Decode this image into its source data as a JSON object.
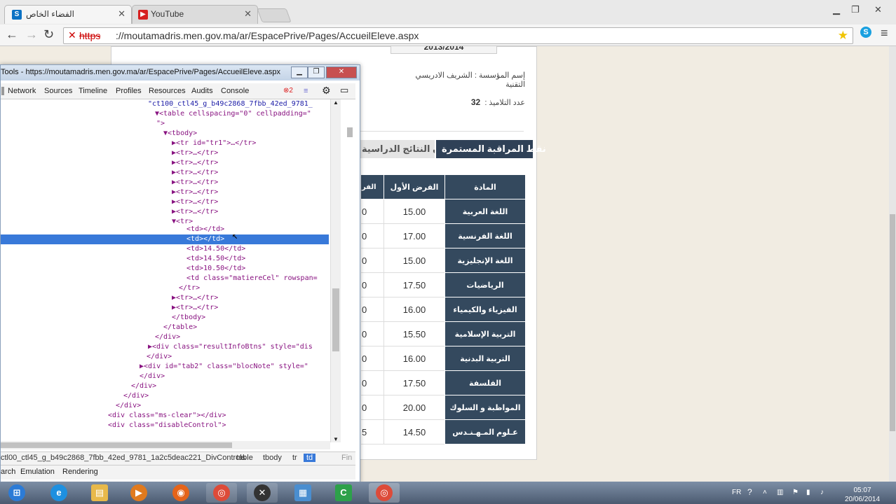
{
  "browser": {
    "tabs": [
      {
        "title": "الفضاء الخاص",
        "icon": "sharepoint-icon"
      },
      {
        "title": "YouTube",
        "icon": "youtube-icon"
      }
    ],
    "url_scheme": "https",
    "url_rest": "://moutamadris.men.gov.ma/ar/EspacePrive/Pages/AccueilEleve.aspx",
    "colors": {
      "titlebar": "#e9e9e9",
      "devtools_selected": "#3879d9",
      "grid_header": "#34495e"
    }
  },
  "page": {
    "info_rows": [
      {
        "label": "إسم المؤسسة :",
        "value": "الشريف الادريسي التقنية"
      },
      {
        "label": "عدد التلاميذ :",
        "value": "32"
      }
    ],
    "top_partial": {
      "value": "2013/2014"
    },
    "tabs": [
      "نقط المراقبة المستمرة",
      "بيان النتائج الدراسية"
    ],
    "table": {
      "columns": [
        "المادة",
        "الفرض الأول",
        "الفر"
      ],
      "rows": [
        {
          "subject": "اللغة العربية",
          "grade1": "15.00",
          "grade2": "0"
        },
        {
          "subject": "اللغة الفرنسية",
          "grade1": "17.00",
          "grade2": "0"
        },
        {
          "subject": "اللغة الإنجليزية",
          "grade1": "15.00",
          "grade2": "0"
        },
        {
          "subject": "الرياضيات",
          "grade1": "17.50",
          "grade2": "0"
        },
        {
          "subject": "الفيزياء والكيمياء",
          "grade1": "16.00",
          "grade2": "0"
        },
        {
          "subject": "التربية الإسلامية",
          "grade1": "15.50",
          "grade2": "0"
        },
        {
          "subject": "التربية البدنية",
          "grade1": "16.00",
          "grade2": "0"
        },
        {
          "subject": "الفلسفة",
          "grade1": "17.50",
          "grade2": "0"
        },
        {
          "subject": "المواظبة و السلوك",
          "grade1": "20.00",
          "grade2": "0"
        },
        {
          "subject": "عـلوم المـهـنـدس",
          "grade1": "14.50",
          "grade2": "5"
        }
      ]
    }
  },
  "devtools": {
    "title": "Tools - https://moutamadris.men.gov.ma/ar/EspacePrive/Pages/AccueilEleve.aspx",
    "tabs": [
      "Network",
      "Sources",
      "Timeline",
      "Profiles",
      "Resources",
      "Audits",
      "Console"
    ],
    "error_count": "2",
    "breadcrumbs": [
      "ctl00_ctl45_g_b49c2868_7fbb_42ed_9781_1a2c5deac221_DivControls",
      "table",
      "tbody",
      "tr",
      "td",
      "Fin"
    ],
    "drawer_tabs": [
      "arch",
      "Emulation",
      "Rendering"
    ],
    "dom_lines": [
      "\"ct100_ctl45_g_b49c2868_7fbb_42ed_9781_",
      "▼<table cellspacing=\"0\" cellpadding=\"",
      "\">",
      "▼<tbody>",
      "▶<tr id=\"tr1\">…</tr>",
      "▶<tr>…</tr>",
      "▶<tr>…</tr>",
      "▶<tr>…</tr>",
      "▶<tr>…</tr>",
      "▶<tr>…</tr>",
      "▶<tr>…</tr>",
      "▶<tr>…</tr>",
      "▼<tr>",
      "<td></td>",
      "<td></td>",
      "<td>14.50</td>",
      "<td>14.50</td>",
      "<td>10.50</td>",
      "<td class=\"matiereCel\" rowspan=",
      "</tr>",
      "▶<tr>…</tr>",
      "▶<tr>…</tr>",
      "</tbody>",
      "</table>",
      "</div>",
      "▶<div class=\"resultInfoBtns\" style=\"dis",
      "</div>",
      "▶<div id=\"tab2\" class=\"blocNote\" style=\"",
      "</div>",
      "</div>",
      "</div>",
      "</div>",
      "<div class=\"ms-clear\"></div>",
      "<div class=\"disableControl\">"
    ]
  },
  "taskbar": {
    "lang": "FR",
    "time": "05:07",
    "date": "20/06/2014"
  }
}
